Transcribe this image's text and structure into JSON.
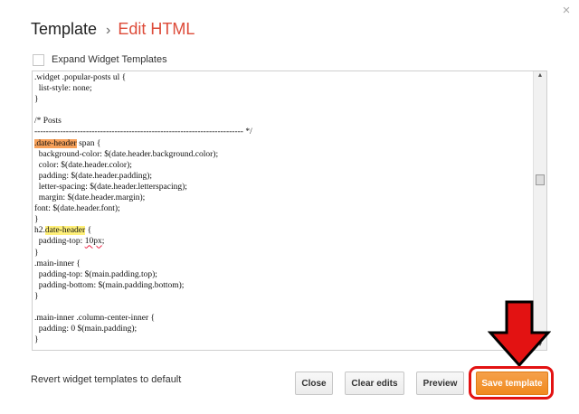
{
  "dialog": {
    "title": "Template",
    "separator": "›",
    "subtitle": "Edit HTML",
    "close_icon": "×"
  },
  "expand": {
    "label": "Expand Widget Templates"
  },
  "code_lines": [
    [
      {
        "t": ".widget .popular-posts ul {"
      }
    ],
    [
      {
        "t": "  list-style: none;"
      }
    ],
    [
      {
        "t": "}"
      }
    ],
    [
      {
        "t": ""
      }
    ],
    [
      {
        "t": "/* Posts"
      }
    ],
    [
      {
        "t": "------------------------------------------------------------------------- */"
      }
    ],
    [
      {
        "t": ".date-header",
        "h": "orange"
      },
      {
        "t": " span {"
      }
    ],
    [
      {
        "t": "  background-color: $(date.header.background.color);"
      }
    ],
    [
      {
        "t": "  color: $(date.header.color);"
      }
    ],
    [
      {
        "t": "  padding: $(date.header.padding);"
      }
    ],
    [
      {
        "t": "  letter-spacing: $(date.header.letterspacing);"
      }
    ],
    [
      {
        "t": "  margin: $(date.header.margin);"
      }
    ],
    [
      {
        "t": "font: $(date.header.font);"
      }
    ],
    [
      {
        "t": "}"
      }
    ],
    [
      {
        "t": "h2."
      },
      {
        "t": "date-header",
        "h": "yellow"
      },
      {
        "t": " {"
      }
    ],
    [
      {
        "t": "  padding-top: "
      },
      {
        "t": "10px",
        "h": "squiggle"
      },
      {
        "t": ";"
      }
    ],
    [
      {
        "t": "}"
      }
    ],
    [
      {
        "t": ".main-inner {"
      }
    ],
    [
      {
        "t": "  padding-top: $(main.padding.top);"
      }
    ],
    [
      {
        "t": "  padding-bottom: $(main.padding.bottom);"
      }
    ],
    [
      {
        "t": "}"
      }
    ],
    [
      {
        "t": ""
      }
    ],
    [
      {
        "t": ".main-inner .column-center-inner {"
      }
    ],
    [
      {
        "t": "  padding: 0 $(main.padding);"
      }
    ],
    [
      {
        "t": "}"
      }
    ]
  ],
  "footer": {
    "revert_label": "Revert widget templates to default",
    "buttons": {
      "close": "Close",
      "clear": "Clear edits",
      "preview": "Preview",
      "save": "Save template"
    }
  },
  "colors": {
    "title_accent": "#dd4b39",
    "save_button": "#f08a1f",
    "annotation_red": "#e31212"
  }
}
